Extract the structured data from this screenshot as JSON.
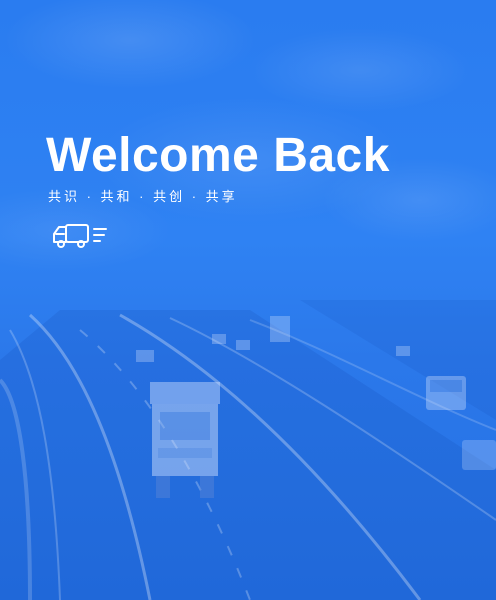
{
  "hero": {
    "title": "Welcome Back",
    "subtitle": "共识 · 共和 · 共创 · 共享",
    "icon": "truck-icon"
  },
  "colors": {
    "background": "#2f82f3",
    "text": "#ffffff"
  }
}
